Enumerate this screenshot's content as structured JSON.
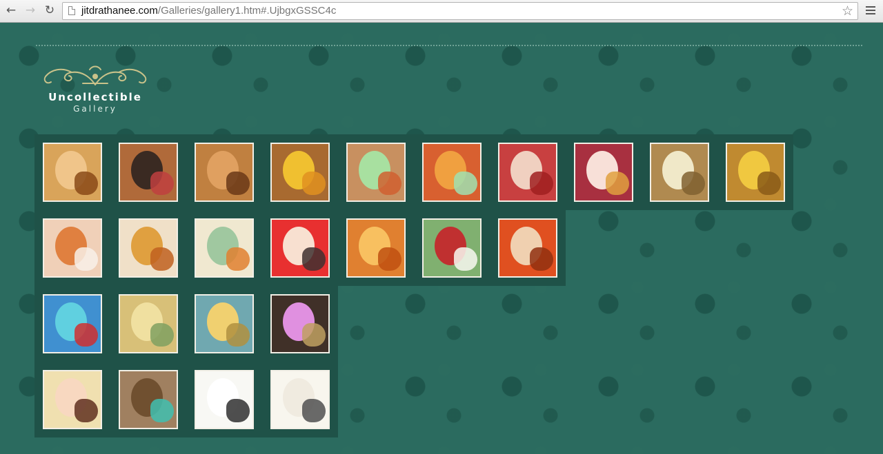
{
  "browser": {
    "url_host": "jitdrathanee.com",
    "url_path": "/Galleries/gallery1.htm#.UjbgxGSSC4c",
    "back_icon": "arrow-left-icon",
    "forward_icon": "arrow-right-icon",
    "reload_icon": "reload-icon",
    "bookmark_icon": "star-icon",
    "menu_icon": "hamburger-icon"
  },
  "logo": {
    "title": "Uncollectible",
    "subtitle": "Gallery",
    "ornament_color": "#c9c28a"
  },
  "colors": {
    "background": "#2b6b5f",
    "panel": "#1f5248",
    "thumb_border": "#f2efe6"
  },
  "gallery": {
    "rows": [
      {
        "thumbs": [
          {
            "name": "thumb-golden-face",
            "bg": "#d9a45a",
            "c1": "#f0c58a",
            "c2": "#8a4a18"
          },
          {
            "name": "thumb-dark-creature-face",
            "bg": "#b06a3a",
            "c1": "#3a2a22",
            "c2": "#c04040"
          },
          {
            "name": "thumb-flame-ornament",
            "bg": "#c08040",
            "c1": "#e0a060",
            "c2": "#6a3818"
          },
          {
            "name": "thumb-yellow-leaf",
            "bg": "#a86a30",
            "c1": "#f0c030",
            "c2": "#e09020"
          },
          {
            "name": "thumb-green-face",
            "bg": "#c89060",
            "c1": "#a8e0a0",
            "c2": "#d06030"
          },
          {
            "name": "thumb-flame-pattern-orange",
            "bg": "#d86030",
            "c1": "#f0a040",
            "c2": "#a0e0b0"
          },
          {
            "name": "thumb-red-naga",
            "bg": "#c84040",
            "c1": "#f0d0c0",
            "c2": "#a02020"
          },
          {
            "name": "thumb-princess-profile",
            "bg": "#a83040",
            "c1": "#f8e0d8",
            "c2": "#e0a040"
          },
          {
            "name": "thumb-pale-face-crown",
            "bg": "#b08a50",
            "c1": "#f0e8c8",
            "c2": "#806030"
          },
          {
            "name": "thumb-golden-swirl",
            "bg": "#c08a30",
            "c1": "#f0c840",
            "c2": "#8a5a18"
          }
        ]
      },
      {
        "thumbs": [
          {
            "name": "thumb-two-faces",
            "bg": "#f0d0b8",
            "c1": "#e08040",
            "c2": "#f8f0e8"
          },
          {
            "name": "thumb-dancer-crown",
            "bg": "#f0e0c8",
            "c1": "#e0a040",
            "c2": "#c06020"
          },
          {
            "name": "thumb-green-deity",
            "bg": "#f0e8d0",
            "c1": "#a0c8a0",
            "c2": "#e08030"
          },
          {
            "name": "thumb-couple",
            "bg": "#e83030",
            "c1": "#f8e0d0",
            "c2": "#403030"
          },
          {
            "name": "thumb-deer",
            "bg": "#e08030",
            "c1": "#f8c060",
            "c2": "#c05010"
          },
          {
            "name": "thumb-green-demon",
            "bg": "#80b070",
            "c1": "#c03030",
            "c2": "#f8f8f0"
          },
          {
            "name": "thumb-orange-demon",
            "bg": "#e05020",
            "c1": "#f0d0b0",
            "c2": "#903010"
          }
        ]
      },
      {
        "thumbs": [
          {
            "name": "thumb-blue-robe",
            "bg": "#4090d0",
            "c1": "#60d0e0",
            "c2": "#d03030"
          },
          {
            "name": "thumb-yellow-face",
            "bg": "#d8c078",
            "c1": "#f0e0a0",
            "c2": "#80a060"
          },
          {
            "name": "thumb-smiling-face",
            "bg": "#70a8b0",
            "c1": "#f0d070",
            "c2": "#b09040"
          },
          {
            "name": "thumb-purple-elephant",
            "bg": "#403028",
            "c1": "#e090e0",
            "c2": "#c0a060"
          }
        ]
      },
      {
        "thumbs": [
          {
            "name": "thumb-reclining-figure",
            "bg": "#f0e0b0",
            "c1": "#f8d8c0",
            "c2": "#603020"
          },
          {
            "name": "thumb-dragon-eye",
            "bg": "#a08060",
            "c1": "#705030",
            "c2": "#40c0b0"
          },
          {
            "name": "thumb-sketch-face",
            "bg": "#f8f8f4",
            "c1": "#ffffff",
            "c2": "#303030"
          },
          {
            "name": "thumb-sketch-profile",
            "bg": "#f8f6ee",
            "c1": "#f0ebe0",
            "c2": "#505050"
          }
        ]
      }
    ]
  }
}
